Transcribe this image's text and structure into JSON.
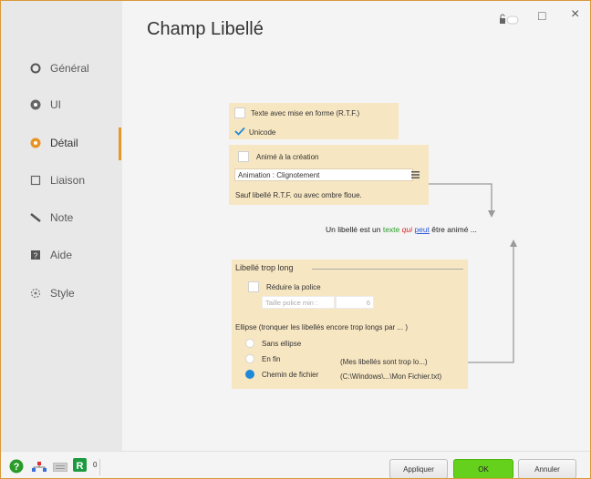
{
  "window": {
    "title": "Champ Libellé",
    "controls": {
      "lock": "lock-icon",
      "maximize": "□",
      "close": "×"
    }
  },
  "sidebar": {
    "items": [
      {
        "label": "Général",
        "icon": "circle-outline-icon"
      },
      {
        "label": "UI",
        "icon": "dot-circle-icon"
      },
      {
        "label": "Détail",
        "icon": "orange-dot-circle-icon"
      },
      {
        "label": "Liaison",
        "icon": "rectangle-icon"
      },
      {
        "label": "Note",
        "icon": "pen-icon"
      },
      {
        "label": "Aide",
        "icon": "help-square-icon"
      },
      {
        "label": "Style",
        "icon": "style-icon"
      }
    ],
    "active_index": 2,
    "accent": "#e39a2b"
  },
  "rtf_panel": {
    "rtf_label": "Texte avec mise en forme (R.T.F.)",
    "unicode_label": "Unicode",
    "unicode_checked": true
  },
  "anim_panel": {
    "anim_label": "Animé à la création",
    "animation_value": "Animation : Clignotement",
    "note": "Sauf libellé R.T.F. ou avec ombre floue."
  },
  "preview": {
    "part1": "Un libellé est un ",
    "texte": "texte",
    "qui": " qui ",
    "peut": "peut",
    "part2": " être animé ...",
    "colors": {
      "texte": "#2c9c2c",
      "qui": "#d22",
      "peut": "#2f5ad8"
    }
  },
  "long_panel": {
    "group_title": "Libellé trop long",
    "reduce_label": "Réduire la police",
    "min_size_label": "Taille police min :",
    "min_size_value": "6",
    "ellipsis_title": "Ellipse (tronquer les libellés encore trop longs par ... )",
    "options": [
      {
        "label": "Sans ellipse",
        "example": "",
        "selected": false
      },
      {
        "label": "En fin",
        "example": "(Mes libellés sont trop lo...)",
        "selected": false
      },
      {
        "label": "Chemin de fichier",
        "example": "(C:\\Windows\\...\\Mon Fichier.txt)",
        "selected": true
      }
    ]
  },
  "bottom": {
    "count": "0",
    "apply_label": "Appliquer",
    "ok_label": "OK",
    "cancel_label": "Annuler",
    "ok_color": "#66d11c"
  }
}
